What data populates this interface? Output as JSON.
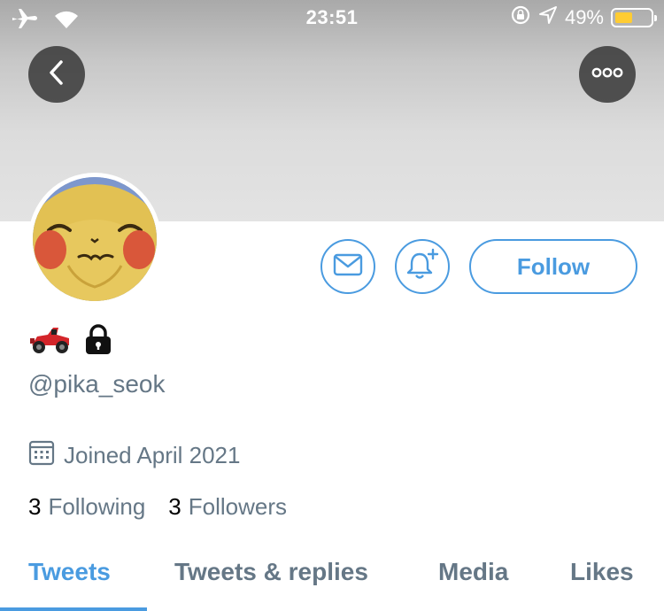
{
  "status_bar": {
    "time": "23:51",
    "battery_percent": "49%",
    "battery_level": 0.49,
    "icons": [
      "airplane-icon",
      "wifi-icon",
      "rotation-lock-icon",
      "location-arrow-icon",
      "battery-icon"
    ]
  },
  "header": {
    "back_icon": "chevron-left-icon",
    "more_icon": "ellipsis-icon"
  },
  "profile": {
    "name_emojis": [
      "racing-car-emoji",
      "lock-icon"
    ],
    "handle": "@pika_seok",
    "joined": "Joined April 2021",
    "following_count": "3",
    "following_label": "Following",
    "followers_count": "3",
    "followers_label": "Followers"
  },
  "actions": {
    "message_icon": "envelope-icon",
    "notification_icon": "bell-plus-icon",
    "follow_label": "Follow"
  },
  "tabs": [
    {
      "label": "Tweets",
      "active": true
    },
    {
      "label": "Tweets & replies",
      "active": false
    },
    {
      "label": "Media",
      "active": false
    },
    {
      "label": "Likes",
      "active": false
    }
  ],
  "colors": {
    "accent": "#4a9be0",
    "secondary_text": "#657786",
    "battery": "#ffcc33"
  }
}
